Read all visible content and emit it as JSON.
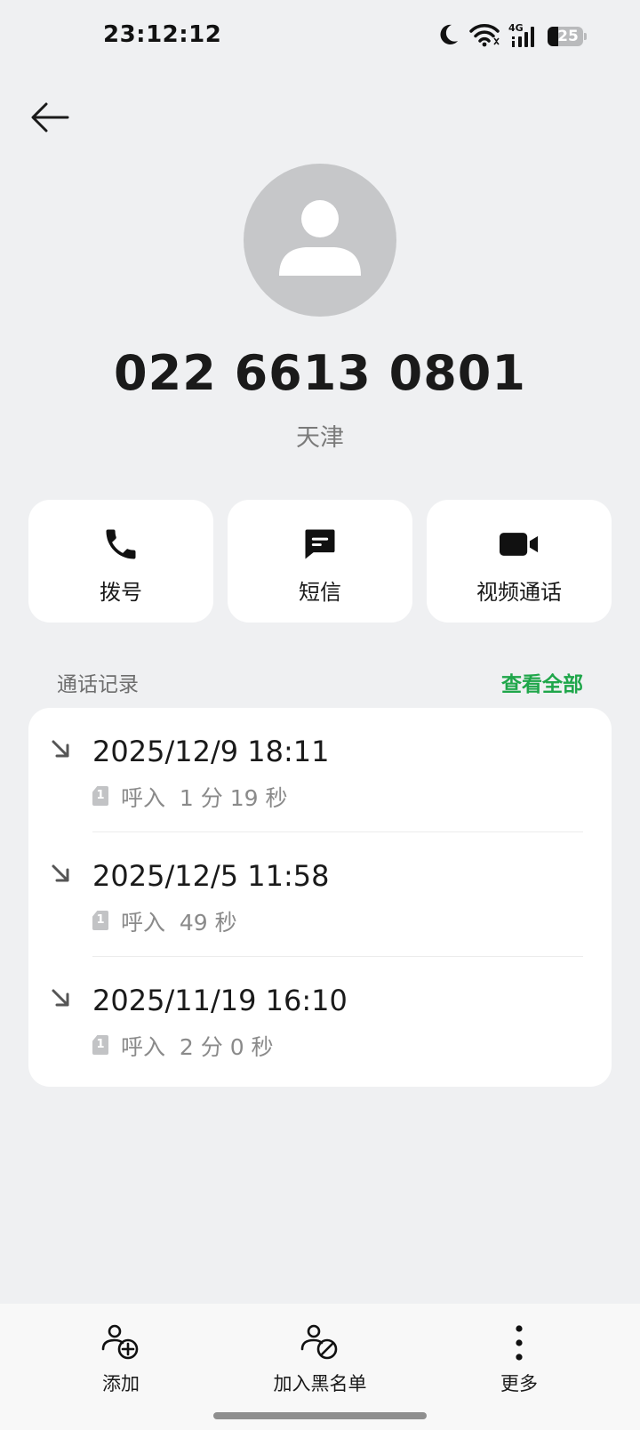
{
  "status_bar": {
    "time": "23:12:12",
    "network": "4G",
    "battery": "25",
    "icons": [
      "moon-icon",
      "wifi-icon",
      "cellular-signal-icon",
      "battery-icon"
    ]
  },
  "header": {
    "back_icon": "arrow-left-icon"
  },
  "contact": {
    "avatar_icon": "person-icon",
    "number": "022 6613 0801",
    "location": "天津"
  },
  "actions": [
    {
      "label": "拨号",
      "icon": "phone-icon"
    },
    {
      "label": "短信",
      "icon": "message-icon"
    },
    {
      "label": "视频通话",
      "icon": "video-camera-icon"
    }
  ],
  "call_log": {
    "title": "通话记录",
    "view_all": "查看全部",
    "entries": [
      {
        "datetime": "2025/12/9 18:11",
        "sim": "1",
        "detail": "呼入  1 分 19 秒"
      },
      {
        "datetime": "2025/12/5 11:58",
        "sim": "1",
        "detail": "呼入  49 秒"
      },
      {
        "datetime": "2025/11/19 16:10",
        "sim": "1",
        "detail": "呼入  2 分 0 秒"
      }
    ]
  },
  "bottom_bar": [
    {
      "label": "添加",
      "icon": "add-contact-icon"
    },
    {
      "label": "加入黑名单",
      "icon": "block-contact-icon"
    },
    {
      "label": "更多",
      "icon": "more-vertical-icon"
    }
  ],
  "colors": {
    "background": "#eff0f2",
    "card": "#ffffff",
    "accent_green": "#1fa64a",
    "avatar_bg": "#c6c7c9"
  }
}
